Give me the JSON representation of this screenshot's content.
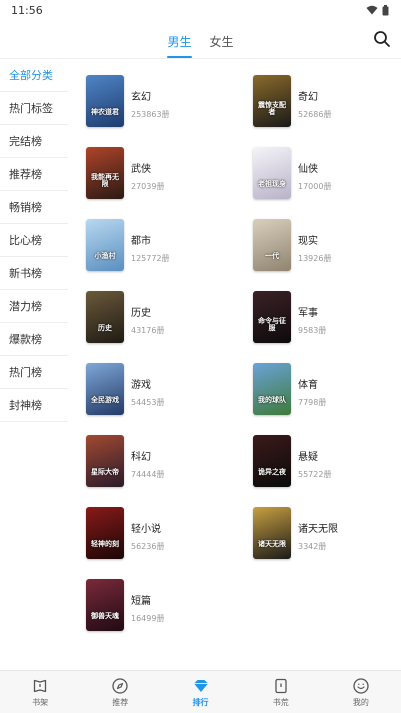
{
  "status": {
    "time": "11:56"
  },
  "tabs": [
    {
      "label": "男生",
      "active": true
    },
    {
      "label": "女生",
      "active": false
    }
  ],
  "sidebar": {
    "items": [
      {
        "label": "全部分类",
        "active": true
      },
      {
        "label": "热门标签"
      },
      {
        "label": "完结榜"
      },
      {
        "label": "推荐榜"
      },
      {
        "label": "畅销榜"
      },
      {
        "label": "比心榜"
      },
      {
        "label": "新书榜"
      },
      {
        "label": "潜力榜"
      },
      {
        "label": "爆款榜"
      },
      {
        "label": "热门榜"
      },
      {
        "label": "封神榜"
      }
    ]
  },
  "categories": [
    {
      "name": "玄幻",
      "count": "253863册",
      "cover_text": "神农道君",
      "cover_colors": [
        "#4f86c6",
        "#1e3b6e"
      ]
    },
    {
      "name": "奇幻",
      "count": "52686册",
      "cover_text": "震惊支配者",
      "cover_colors": [
        "#8a6a2a",
        "#1a1a1a"
      ]
    },
    {
      "name": "武侠",
      "count": "27039册",
      "cover_text": "我能再无限",
      "cover_colors": [
        "#b0442a",
        "#2a1a14"
      ]
    },
    {
      "name": "仙侠",
      "count": "17000册",
      "cover_text": "老祖现身",
      "cover_colors": [
        "#f4f4f8",
        "#b9b2c8"
      ]
    },
    {
      "name": "都市",
      "count": "125772册",
      "cover_text": "小渔村",
      "cover_colors": [
        "#b8d8f0",
        "#5a8fc0"
      ]
    },
    {
      "name": "现实",
      "count": "13926册",
      "cover_text": "一代",
      "cover_colors": [
        "#d9cfbd",
        "#8f8470"
      ]
    },
    {
      "name": "历史",
      "count": "43176册",
      "cover_text": "历史",
      "cover_colors": [
        "#6b5a3a",
        "#1f1a14"
      ]
    },
    {
      "name": "军事",
      "count": "9583册",
      "cover_text": "命令与征服",
      "cover_colors": [
        "#3a2226",
        "#0e0a0c"
      ]
    },
    {
      "name": "游戏",
      "count": "54453册",
      "cover_text": "全民游戏",
      "cover_colors": [
        "#7fa8d8",
        "#233a66"
      ]
    },
    {
      "name": "体育",
      "count": "7798册",
      "cover_text": "我的球队",
      "cover_colors": [
        "#6aa3d8",
        "#3f7a3a"
      ]
    },
    {
      "name": "科幻",
      "count": "74444册",
      "cover_text": "星际大帝",
      "cover_colors": [
        "#a24a32",
        "#2a1a2a"
      ]
    },
    {
      "name": "悬疑",
      "count": "55722册",
      "cover_text": "诡异之夜",
      "cover_colors": [
        "#3c1a1a",
        "#0a0a0a"
      ]
    },
    {
      "name": "轻小说",
      "count": "56236册",
      "cover_text": "轻神的刻",
      "cover_colors": [
        "#8a1a1a",
        "#1a0606"
      ]
    },
    {
      "name": "诸天无限",
      "count": "3342册",
      "cover_text": "诸天无限",
      "cover_colors": [
        "#c8a040",
        "#1a1a1a"
      ]
    },
    {
      "name": "短篇",
      "count": "16499册",
      "cover_text": "御兽天魂",
      "cover_colors": [
        "#7a2a3a",
        "#200a14"
      ]
    }
  ],
  "bottom_nav": [
    {
      "label": "书架",
      "icon": "bookshelf-icon"
    },
    {
      "label": "推荐",
      "icon": "compass-icon"
    },
    {
      "label": "排行",
      "icon": "diamond-icon",
      "active": true
    },
    {
      "label": "书荒",
      "icon": "book-icon"
    },
    {
      "label": "我的",
      "icon": "smile-icon"
    }
  ],
  "colors": {
    "accent": "#2196e8",
    "muted": "#999999"
  }
}
